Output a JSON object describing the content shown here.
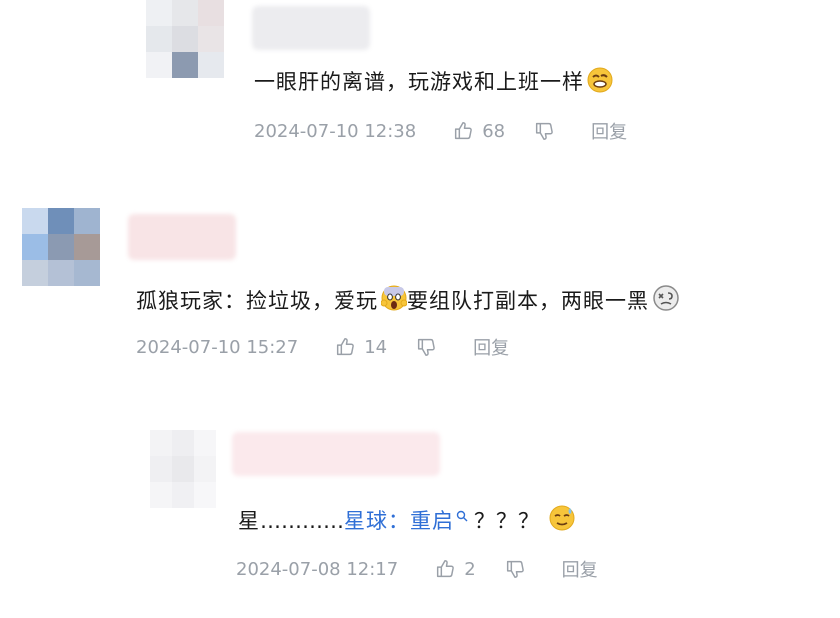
{
  "comments": [
    {
      "text": "一眼肝的离谱，玩游戏和上班一样",
      "emoji": "grimace-emoji",
      "time": "2024-07-10 12:38",
      "likes": "68",
      "reply": "回复"
    },
    {
      "prefix": "孤狼玩家：",
      "text_a": "捡垃圾，爱玩",
      "emoji_mid": "scream-emoji",
      "text_b": "要组队打副本，两眼一黑",
      "emoji_end": "dizzy-emoji",
      "time": "2024-07-10 15:27",
      "likes": "14",
      "reply": "回复"
    },
    {
      "lead": "星",
      "dots": "…………",
      "mention": "星球：重启",
      "search_icon": "search-icon",
      "tail": "？？？",
      "emoji": "sweat-emoji",
      "time": "2024-07-08 12:17",
      "likes": "2",
      "reply": "回复"
    }
  ],
  "colors": {
    "meta": "#9aa0a8",
    "mention": "#2f6fd6",
    "emoji": "#f7c53a"
  }
}
